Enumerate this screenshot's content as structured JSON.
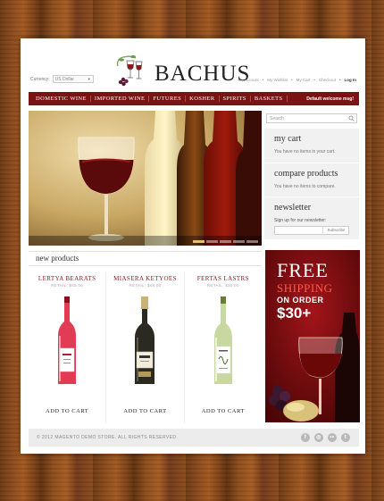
{
  "header": {
    "currency_label": "Currency:",
    "currency_value": "US Dollar",
    "logo_text": "BACHUS",
    "top_links": [
      "My Account",
      "My Wishlist",
      "My Cart",
      "Checkout"
    ],
    "login_label": "Log In"
  },
  "nav": {
    "items": [
      "DOMESTIC WINE",
      "IMPORTED WINE",
      "FUTURES",
      "KOSHER",
      "SPIRITS",
      "BASKETS"
    ],
    "welcome": "Default welcome msg!"
  },
  "search": {
    "placeholder": "Search"
  },
  "cart": {
    "title": "my cart",
    "text": "You have no items in your cart."
  },
  "compare": {
    "title": "compare products",
    "text": "You have no items to compare."
  },
  "newsletter": {
    "title": "newsletter",
    "label": "Sign up for our newsletter:",
    "button": "Subscribe"
  },
  "new_products": {
    "title": "new products",
    "items": [
      {
        "name": "LERTYA BEARATS",
        "price": "RETAIL: $65.00",
        "add": "ADD TO CART",
        "label_color": "#e7425a"
      },
      {
        "name": "MIASERA KETYOES",
        "price": "RETAIL: $48.00",
        "add": "ADD TO CART",
        "label_color": "#2a2a22"
      },
      {
        "name": "FERTAS LASTRS",
        "price": "RETAIL: $30.00",
        "add": "ADD TO CART",
        "label_color": "#c9d8a0"
      }
    ]
  },
  "promo": {
    "line1": "FREE",
    "line2": "SHIPPING",
    "line3": "ON ORDER",
    "line4": "$30+"
  },
  "footer": {
    "copyright": "© 2012 MAGENTO DEMO STORE. ALL RIGHTS RESERVED.",
    "social_icons": [
      "facebook-icon",
      "globe-icon",
      "flickr-icon",
      "twitter-icon"
    ]
  },
  "colors": {
    "nav_bg": "#7a1313",
    "accent_red": "#8a1818",
    "promo_bg": "#6a0c0c"
  }
}
